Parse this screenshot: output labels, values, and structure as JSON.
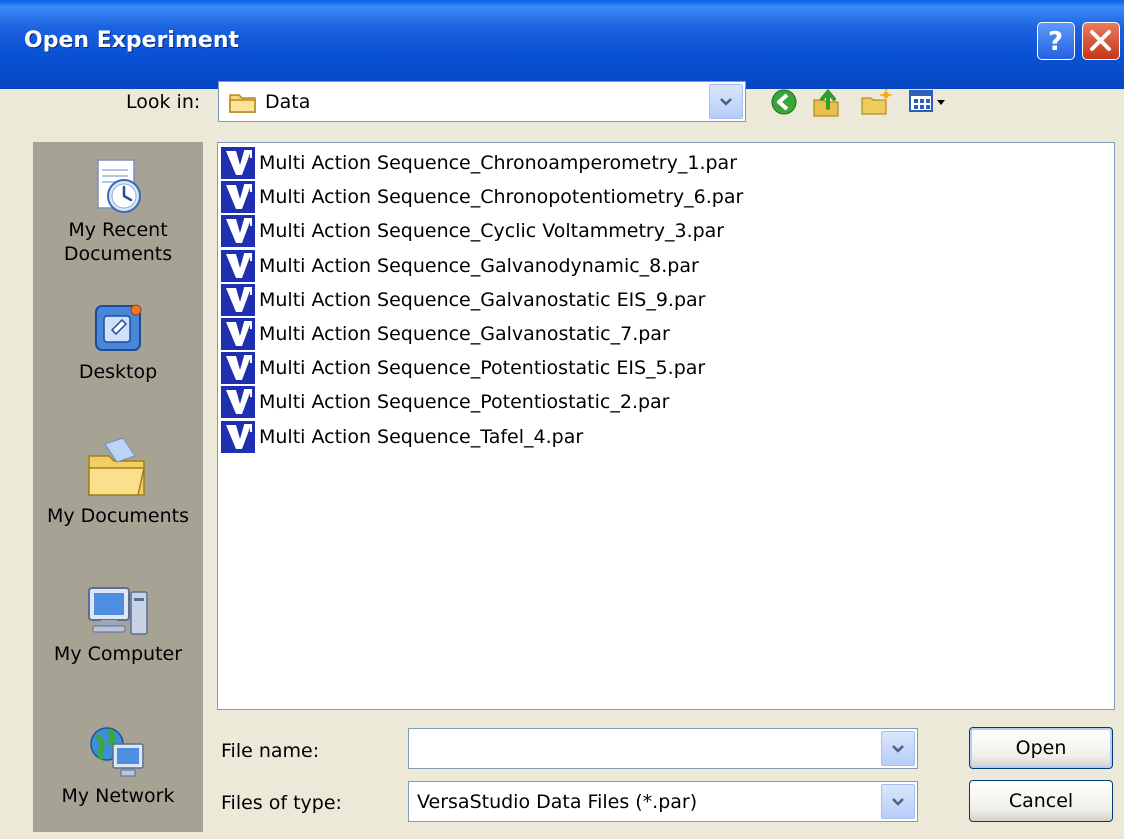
{
  "window": {
    "title": "Open Experiment"
  },
  "lookin": {
    "label": "Look in:",
    "value": "Data"
  },
  "toolbar": {
    "back_icon": "back-arrow-icon",
    "up_icon": "up-folder-icon",
    "new_folder_icon": "new-folder-icon",
    "views_icon": "views-menu-icon"
  },
  "places": [
    {
      "label_line1": "My Recent",
      "label_line2": "Documents",
      "icon": "recent-documents-icon"
    },
    {
      "label_line1": "Desktop",
      "label_line2": "",
      "icon": "desktop-icon"
    },
    {
      "label_line1": "My Documents",
      "label_line2": "",
      "icon": "my-documents-icon"
    },
    {
      "label_line1": "My Computer",
      "label_line2": "",
      "icon": "my-computer-icon"
    },
    {
      "label_line1": "My Network",
      "label_line2": "",
      "icon": "my-network-icon"
    }
  ],
  "files": [
    "Multi Action Sequence_Chronoamperometry_1.par",
    "Multi Action Sequence_Chronopotentiometry_6.par",
    "Multi Action Sequence_Cyclic Voltammetry_3.par",
    "Multi Action Sequence_Galvanodynamic_8.par",
    "Multi Action Sequence_Galvanostatic EIS_9.par",
    "Multi Action Sequence_Galvanostatic_7.par",
    "Multi Action Sequence_Potentiostatic EIS_5.par",
    "Multi Action Sequence_Potentiostatic_2.par",
    "Multi Action Sequence_Tafel_4.par"
  ],
  "filename": {
    "label": "File name:",
    "value": ""
  },
  "filetype": {
    "label": "Files of type:",
    "value": "VersaStudio Data Files (*.par)"
  },
  "buttons": {
    "open": "Open",
    "cancel": "Cancel"
  },
  "colors": {
    "titlebar": "#0a52d6",
    "file_icon": "#1e2fb0",
    "places_bg": "#a6a395"
  }
}
